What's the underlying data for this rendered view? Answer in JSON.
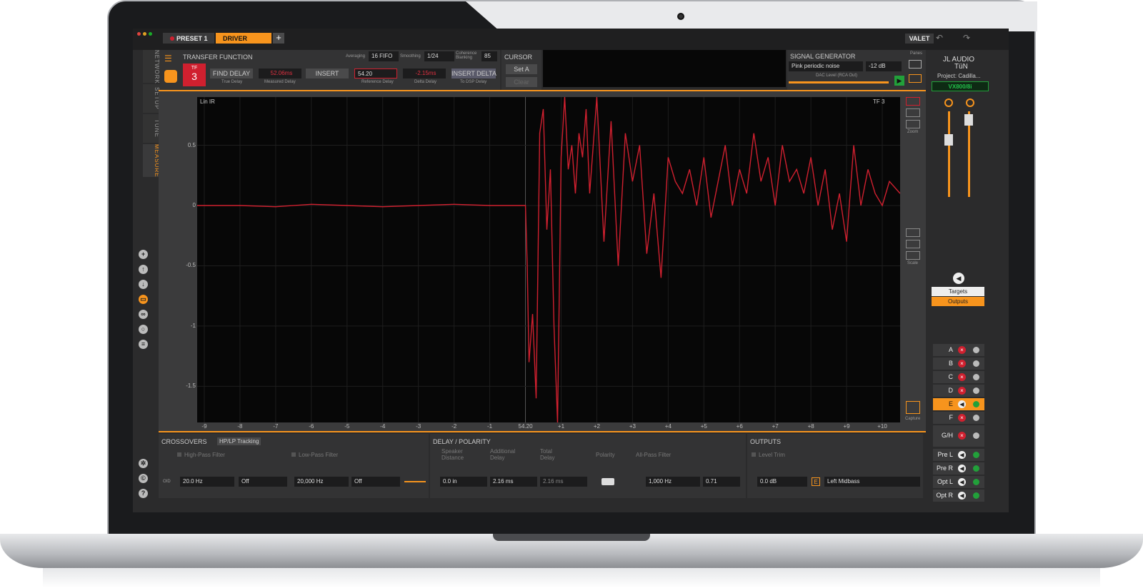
{
  "window": {
    "preset_tab": "PRESET 1",
    "driver_tab": "DRIVER",
    "add_tab": "+",
    "valet": "VALET",
    "undo_icon": "undo-arrow-icon",
    "redo_icon": "redo-arrow-icon"
  },
  "sidebar": {
    "tabs": [
      "NETWORK",
      "SETUP",
      "TUNE",
      "MEASURE"
    ],
    "icons": [
      "add-icon",
      "upload-icon",
      "download-icon",
      "folder-icon",
      "link-icon",
      "search-icon",
      "list-icon",
      "gear-icon",
      "copyright-icon",
      "help-icon"
    ]
  },
  "transfer_function": {
    "title": "TRANSFER FUNCTION",
    "averaging_label": "Averaging",
    "averaging_value": "16 FIFO",
    "smoothing_label": "Smoothing",
    "smoothing_value": "1/24",
    "coherence_label": "Coherence Blanking",
    "coherence_value": "85",
    "tf_badge_label": "TF",
    "tf_badge_value": "3",
    "find_delay": "FIND DELAY",
    "measured_delay": "52.06ms",
    "insert": "INSERT",
    "reference_delay": "54.20",
    "delta_delay": "-2.15ms",
    "insert_delta": "INSERT DELTA",
    "true_delay_label": "True Delay",
    "measured_delay_label": "Measured Delay",
    "reference_delay_label": "Reference Delay",
    "delta_delay_label": "Delta Delay",
    "to_dsp_label": "To DSP Delay"
  },
  "cursor": {
    "title": "CURSOR",
    "set_a": "Set A",
    "clear": "Clear"
  },
  "signal_generator": {
    "title": "SIGNAL GENERATOR",
    "signal": "Pink periodic noise",
    "level": "-12 dB",
    "dac_label": "DAC Level (RCA Out)",
    "panes_label": "Panes"
  },
  "plot": {
    "mode": "Lin IR",
    "trace": "TF 3",
    "zoom_label": "Zoom",
    "scale_label": "Scale",
    "capture_label": "Capture",
    "trace_color": "#d0202f"
  },
  "chart_data": {
    "type": "line",
    "title": "",
    "xlabel": "",
    "ylabel": "",
    "x_ticks": [
      "-9",
      "-8",
      "-7",
      "-6",
      "-5",
      "-4",
      "-3",
      "-2",
      "-1",
      "54.20",
      "+1",
      "+2",
      "+3",
      "+4",
      "+5",
      "+6",
      "+7",
      "+8",
      "+9",
      "+10"
    ],
    "y_ticks": [
      "0.5",
      "0",
      "-0.5",
      "-1",
      "-1.5"
    ],
    "xlim": [
      -9.2,
      10.5
    ],
    "ylim": [
      -1.8,
      0.9
    ],
    "series": [
      {
        "x": [
          -9.2,
          -8,
          -7,
          -6,
          -5,
          -4,
          -3,
          -2,
          -1,
          0,
          0.05,
          0.1,
          0.2,
          0.3,
          0.4,
          0.5,
          0.6,
          0.7,
          0.8,
          0.9,
          1.0,
          1.1,
          1.2,
          1.3,
          1.4,
          1.5,
          1.6,
          1.7,
          1.8,
          1.9,
          2.0,
          2.2,
          2.4,
          2.6,
          2.8,
          3.0,
          3.2,
          3.4,
          3.6,
          3.8,
          4.0,
          4.2,
          4.4,
          4.6,
          4.8,
          5.0,
          5.2,
          5.4,
          5.6,
          5.8,
          6.0,
          6.2,
          6.4,
          6.6,
          6.8,
          7.0,
          7.2,
          7.4,
          7.6,
          7.8,
          8.0,
          8.2,
          8.4,
          8.6,
          8.8,
          9.0,
          9.2,
          9.4,
          9.6,
          9.8,
          10.0,
          10.2,
          10.5
        ],
        "y": [
          0.0,
          0.0,
          -0.01,
          0.01,
          0.0,
          -0.01,
          0.0,
          0.01,
          0.0,
          0.0,
          -0.5,
          -1.3,
          -0.9,
          -1.6,
          0.6,
          0.8,
          -0.2,
          0.3,
          -1.0,
          -1.8,
          0.4,
          0.9,
          0.3,
          0.5,
          0.1,
          0.6,
          0.4,
          0.8,
          0.1,
          0.5,
          0.9,
          -0.3,
          0.7,
          -0.5,
          0.6,
          0.2,
          0.5,
          -0.4,
          0.1,
          -0.6,
          0.4,
          0.2,
          0.1,
          0.3,
          0.0,
          0.4,
          -0.1,
          0.2,
          0.5,
          0.0,
          0.3,
          0.1,
          0.6,
          0.2,
          0.4,
          0.0,
          0.5,
          0.2,
          0.3,
          0.1,
          0.4,
          0.0,
          0.3,
          -0.2,
          0.1,
          -0.3,
          0.5,
          0.0,
          0.3,
          0.1,
          0.0,
          0.2,
          0.1
        ]
      }
    ]
  },
  "crossovers": {
    "title": "CROSSOVERS",
    "tracking": "HP/LP Tracking",
    "hp_label": "High-Pass Filter",
    "lp_label": "Low-Pass Filter",
    "hp_freq": "20.0 Hz",
    "hp_type": "Off",
    "lp_freq": "20,000 Hz",
    "lp_type": "Off",
    "link_label": "OID"
  },
  "delay": {
    "title": "DELAY / POLARITY",
    "speaker_distance": "Speaker Distance",
    "additional_delay": "Additional Delay",
    "total_delay": "Total Delay",
    "polarity": "Polarity",
    "allpass": "All-Pass Filter",
    "distance_value": "0.0 in",
    "additional_value": "2.16 ms",
    "total_value": "2.16 ms",
    "allpass_freq": "1,000 Hz",
    "allpass_q": "0.71"
  },
  "outputs": {
    "title": "OUTPUTS",
    "level_trim": "Level Trim",
    "trim_value": "0.0 dB",
    "badge": "E",
    "name": "Left Midbass"
  },
  "right_panel": {
    "brand": "JL AUDIO",
    "brand_sub": "TüN",
    "project": "Project: Cadilla...",
    "device": "VX800/8i",
    "targets": "Targets",
    "outputs": "Outputs",
    "channels": [
      {
        "label": "A",
        "state": "mute"
      },
      {
        "label": "B",
        "state": "mute"
      },
      {
        "label": "C",
        "state": "mute"
      },
      {
        "label": "D",
        "state": "mute"
      },
      {
        "label": "E",
        "state": "on"
      },
      {
        "label": "F",
        "state": "mute"
      },
      {
        "label": "G/H",
        "state": "mute"
      },
      {
        "label": "Pre L",
        "state": "on"
      },
      {
        "label": "Pre R",
        "state": "on"
      },
      {
        "label": "Opt L",
        "state": "on"
      },
      {
        "label": "Opt R",
        "state": "on"
      }
    ],
    "accent": "#f7941d",
    "status_green": "#22a03a"
  }
}
